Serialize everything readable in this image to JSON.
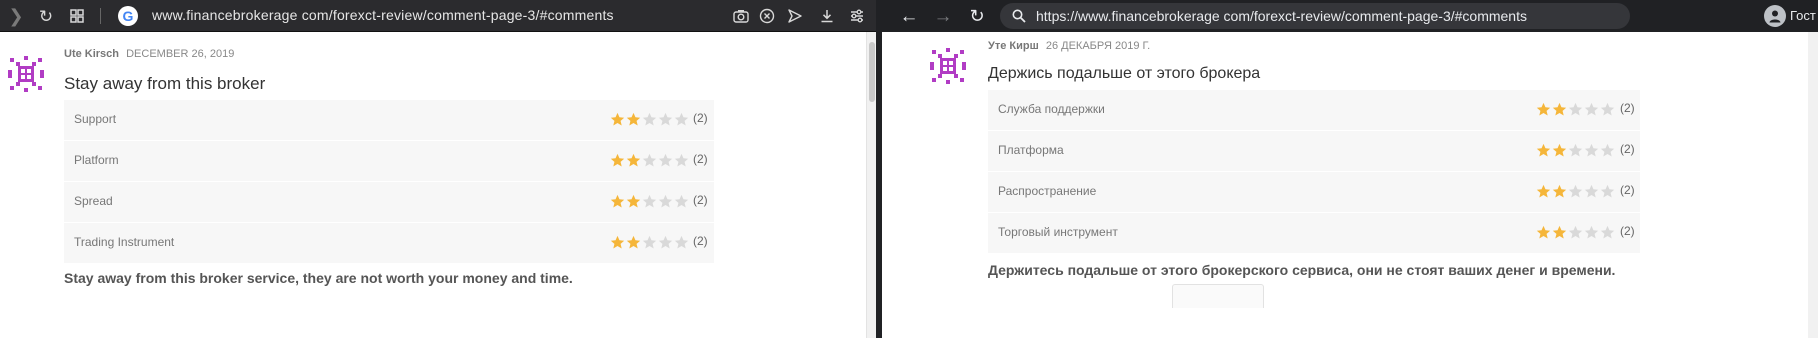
{
  "colors": {
    "star_filled": "#f5b63a",
    "star_empty": "#d9d9d9",
    "avatar": "#b13cc4",
    "left_toolbar": "#2b2b2e",
    "right_toolbar": "#202124"
  },
  "left_window": {
    "url": "www.financebrokerage com/forexct-review/comment-page-3/#comments",
    "google_badge": "G",
    "comment": {
      "author": "Ute Kirsch",
      "date": "DECEMBER 26, 2019",
      "title": "Stay away from this broker",
      "ratings": [
        {
          "label": "Support",
          "stars": 2,
          "count": "(2)"
        },
        {
          "label": "Platform",
          "stars": 2,
          "count": "(2)"
        },
        {
          "label": "Spread",
          "stars": 2,
          "count": "(2)"
        },
        {
          "label": "Trading Instrument",
          "stars": 2,
          "count": "(2)"
        }
      ],
      "body": "Stay away from this broker service, they are not worth your money and time."
    }
  },
  "right_window": {
    "url": "https://www.financebrokerage com/forexct-review/comment-page-3/#comments",
    "guest_label": "Гост",
    "comment": {
      "author": "Уте Кирш",
      "date": "26 ДЕКАБРЯ 2019 Г.",
      "title": "Держись подальше от этого брокера",
      "ratings": [
        {
          "label": "Служба поддержки",
          "stars": 2,
          "count": "(2)"
        },
        {
          "label": "Платформа",
          "stars": 2,
          "count": "(2)"
        },
        {
          "label": "Распространение",
          "stars": 2,
          "count": "(2)"
        },
        {
          "label": "Торговый инструмент",
          "stars": 2,
          "count": "(2)"
        }
      ],
      "body": "Держитесь подальше от этого брокерского сервиса, они не стоят ваших денег и времени."
    }
  }
}
